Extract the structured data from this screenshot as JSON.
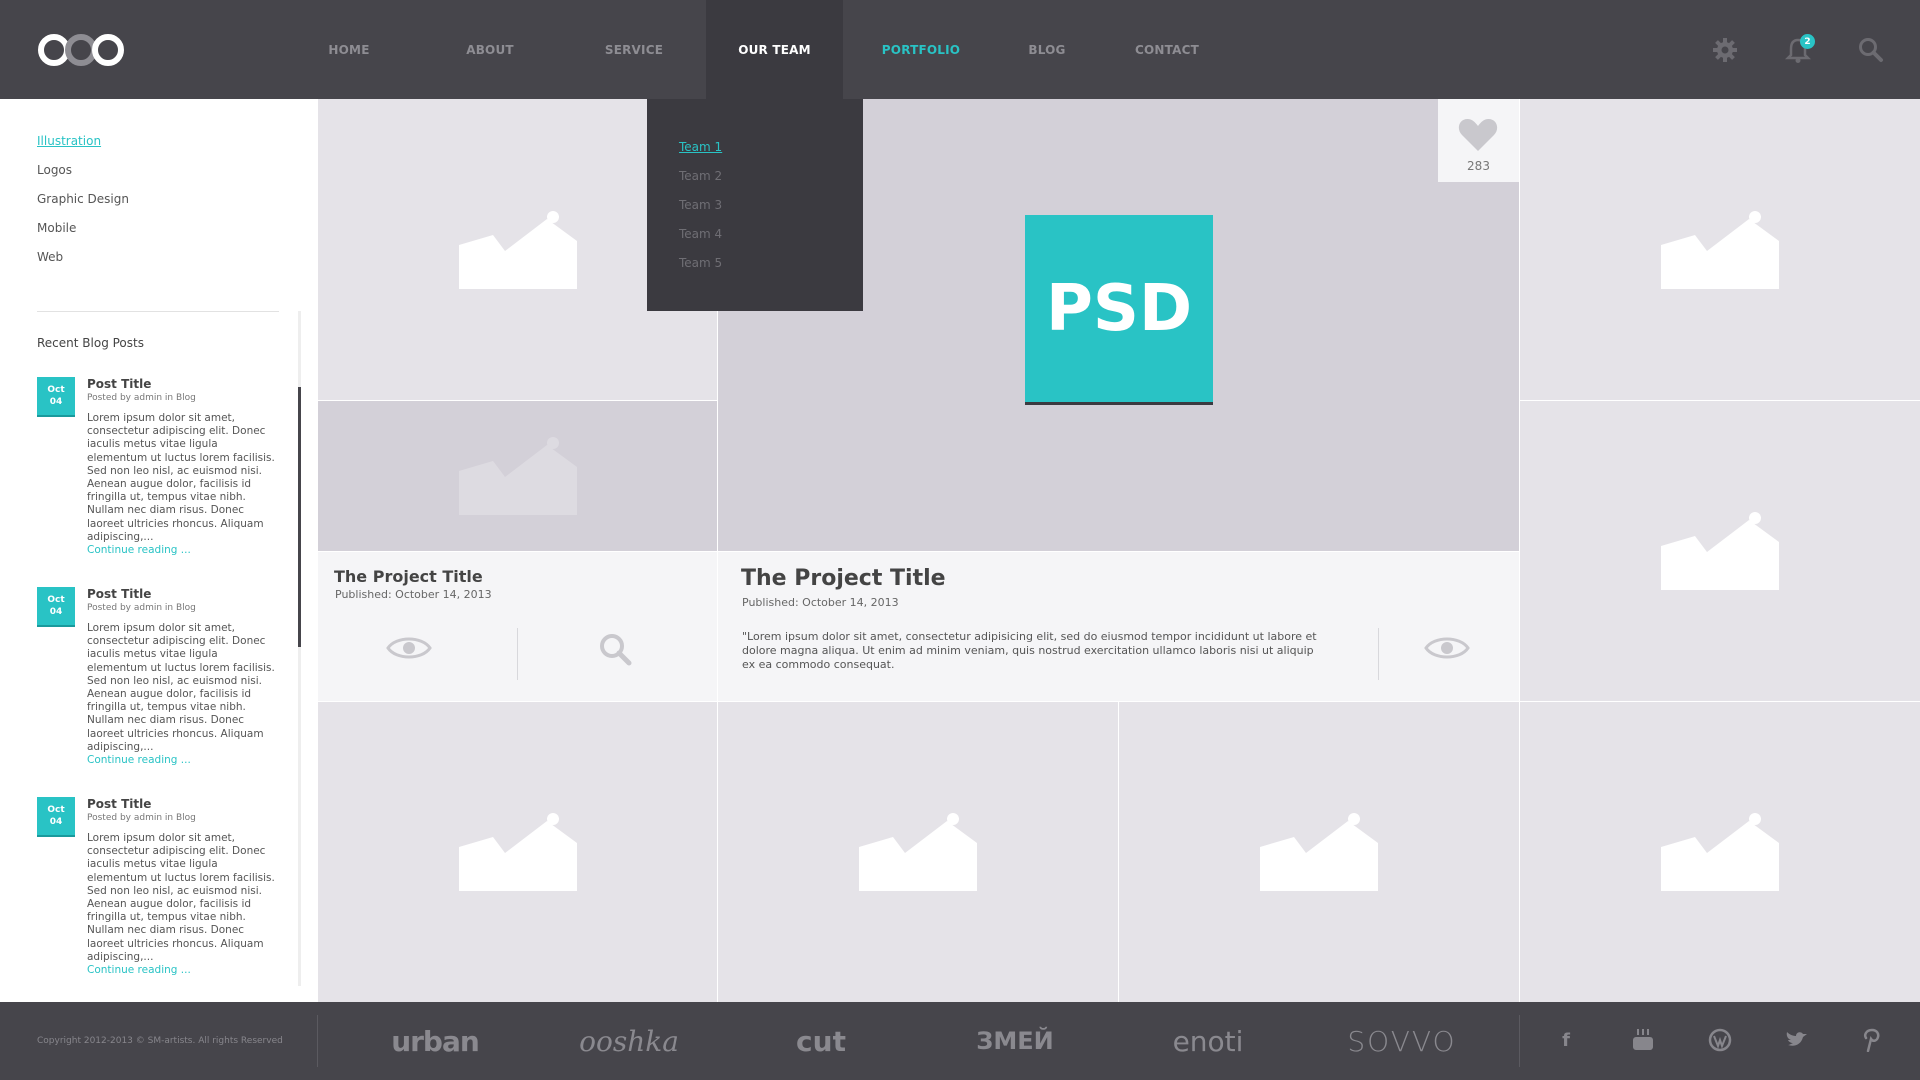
{
  "nav": {
    "items": [
      {
        "label": "HOME"
      },
      {
        "label": "ABOUT"
      },
      {
        "label": "SERVICE"
      },
      {
        "label": "OUR TEAM"
      },
      {
        "label": "PORTFOLIO"
      },
      {
        "label": "BLOG"
      },
      {
        "label": "CONTACT"
      }
    ],
    "notification_count": "2",
    "dropdown": [
      "Team 1",
      "Team 2",
      "Team 3",
      "Team 4",
      "Team 5"
    ]
  },
  "sidebar": {
    "categories": [
      "Illustration",
      "Logos",
      "Graphic Design",
      "Mobile",
      "Web"
    ],
    "recent_title": "Recent Blog Posts",
    "posts": [
      {
        "month": "Oct",
        "day": "04",
        "title": "Post Title",
        "meta": "Posted by admin in Blog",
        "body": "Lorem ipsum dolor sit amet, consectetur adipiscing elit. Donec iaculis metus vitae ligula elementum ut luctus lorem facilisis. Sed non leo nisl, ac euismod nisi. Aenean augue dolor, facilisis id fringilla ut, tempus vitae nibh. Nullam nec diam risus. Donec laoreet ultricies rhoncus. Aliquam adipiscing,...",
        "more": "Continue reading ..."
      },
      {
        "month": "Oct",
        "day": "04",
        "title": "Post Title",
        "meta": "Posted by admin in Blog",
        "body": "Lorem ipsum dolor sit amet, consectetur adipiscing elit. Donec iaculis metus vitae ligula elementum ut luctus lorem facilisis. Sed non leo nisl, ac euismod nisi. Aenean augue dolor, facilisis id fringilla ut, tempus vitae nibh. Nullam nec diam risus. Donec laoreet ultricies rhoncus. Aliquam adipiscing,...",
        "more": "Continue reading ..."
      },
      {
        "month": "Oct",
        "day": "04",
        "title": "Post Title",
        "meta": "Posted by admin in Blog",
        "body": "Lorem ipsum dolor sit amet, consectetur adipiscing elit. Donec iaculis metus vitae ligula elementum ut luctus lorem facilisis. Sed non leo nisl, ac euismod nisi. Aenean augue dolor, facilisis id fringilla ut, tempus vitae nibh. Nullam nec diam risus. Donec laoreet ultricies rhoncus. Aliquam adipiscing,...",
        "more": "Continue reading ..."
      }
    ]
  },
  "featured": {
    "badge": "PSD",
    "likes": "283",
    "title": "The Project Title",
    "date": "Published: October 14, 2013",
    "description": "\"Lorem ipsum dolor sit amet, consectetur adipisicing elit, sed do eiusmod tempor incididunt ut labore et dolore magna aliqua. Ut enim ad minim veniam, quis nostrud exercitation ullamco laboris nisi ut aliquip ex ea commodo consequat."
  },
  "small_project": {
    "title": "The Project Title",
    "date": "Published: October 14, 2013"
  },
  "footer": {
    "copyright": "Copyright 2012-2013 © SM-artists. All rights Reserved",
    "brands": [
      "urban",
      "ooshka",
      "cut",
      "ЗМЕЙ",
      "enoti",
      "SOVVO"
    ],
    "social": [
      "facebook-icon",
      "youtube-icon",
      "wordpress-icon",
      "twitter-icon",
      "pinterest-icon"
    ]
  },
  "colors": {
    "accent": "#29c3c5",
    "header_bg": "#46454b",
    "dropdown_bg": "#3b3a40",
    "tile_bg": "#e5e3e8"
  }
}
